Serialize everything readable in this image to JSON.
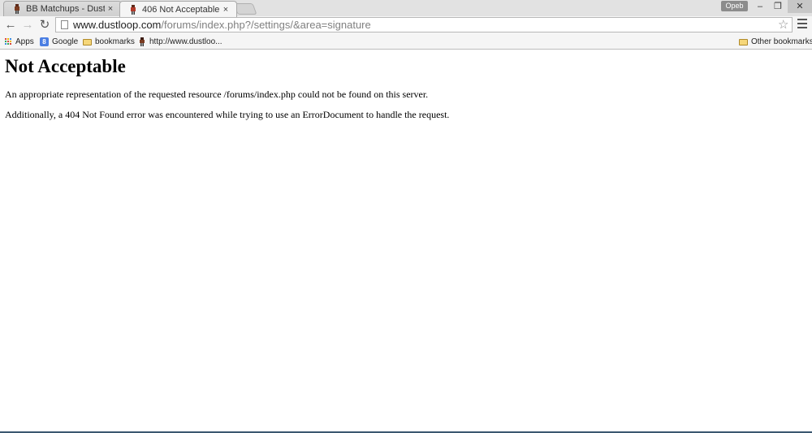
{
  "tabs": [
    {
      "title": "BB Matchups - Dustloop F",
      "close": "×",
      "active": false
    },
    {
      "title": "406 Not Acceptable",
      "close": "×",
      "active": true
    }
  ],
  "window": {
    "profile": "Opeb",
    "minimize": "–",
    "restore": "❐",
    "close": "✕"
  },
  "toolbar": {
    "back": "←",
    "forward": "→",
    "reload": "↻",
    "url_host": "www.dustloop.com",
    "url_path": "/forums/index.php?/settings/&area=signature",
    "star": "☆"
  },
  "bookmarks": {
    "items": [
      {
        "label": "Apps",
        "icon": "apps-grid-icon"
      },
      {
        "label": "Google",
        "icon": "google-icon"
      },
      {
        "label": "bookmarks",
        "icon": "folder-icon"
      },
      {
        "label": "http://www.dustloo...",
        "icon": "character-favicon-icon"
      }
    ],
    "other": "Other bookmarks"
  },
  "page": {
    "heading": "Not Acceptable",
    "line1": "An appropriate representation of the requested resource /forums/index.php could not be found on this server.",
    "line2": "Additionally, a 404 Not Found error was encountered while trying to use an ErrorDocument to handle the request."
  },
  "colors": {
    "accent": "#3b5770",
    "apps_dots": [
      "#d9453a",
      "#f0b400",
      "#3b8de0",
      "#34a853"
    ]
  }
}
